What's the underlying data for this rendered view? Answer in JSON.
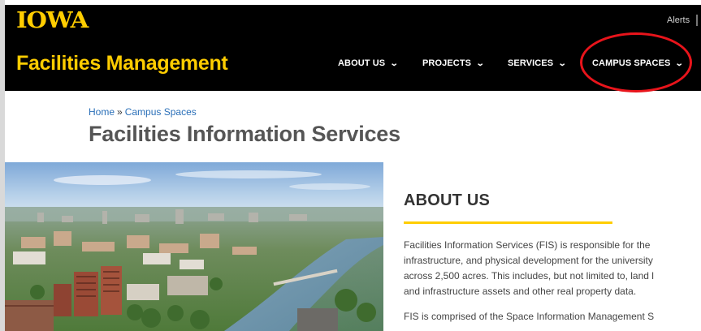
{
  "header": {
    "logo": "IOWA",
    "alerts_label": "Alerts",
    "site_title": "Facilities Management",
    "accent_color": "#FFCD00",
    "nav": [
      {
        "label": "ABOUT US"
      },
      {
        "label": "PROJECTS"
      },
      {
        "label": "SERVICES"
      },
      {
        "label": "CAMPUS SPACES"
      }
    ],
    "highlight_color": "#e8141b"
  },
  "breadcrumb": {
    "home": "Home",
    "separator": "»",
    "current": "Campus Spaces"
  },
  "page_title": "Facilities Information Services",
  "hero_image": {
    "subject": "aerial-campus-photo"
  },
  "about": {
    "heading": "ABOUT US",
    "lines": [
      "Facilities Information Services (FIS) is responsible for the",
      "infrastructure, and physical development for the university",
      "across 2,500 acres. This includes, but not limited to, land l",
      "and infrastructure assets and other real property data.",
      "FIS is comprised of the Space Information Management S"
    ]
  }
}
